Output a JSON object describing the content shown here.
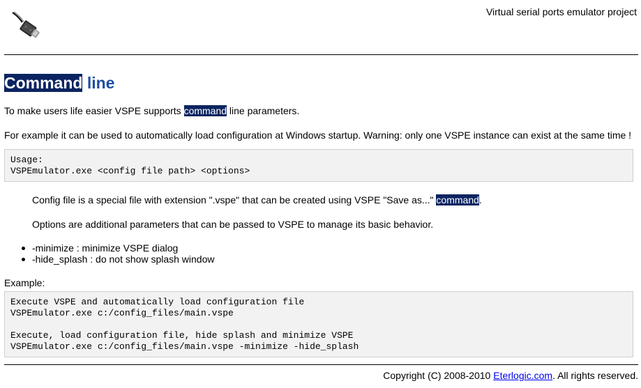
{
  "header": {
    "site_title": "Virtual serial ports emulator project",
    "logo_icon": "serial-cable-icon"
  },
  "main": {
    "heading_highlight": "Command",
    "heading_rest": " line",
    "intro": {
      "before": "To make users life easier VSPE supports ",
      "highlight": "command",
      "after": " line parameters."
    },
    "example_paragraph": "For example it can be used to automatically load configuration at Windows startup. Warning: only one VSPE instance can exist at the same time !",
    "usage_code": "Usage:\nVSPEmulator.exe <config file path> <options>",
    "config_note": {
      "before": "Config file is a special file with extension \".vspe\" that can be created using VSPE \"Save as...\" ",
      "highlight": "command",
      "after": "."
    },
    "options_note": "Options are additional parameters that can be passed to VSPE to manage its basic behavior.",
    "options": [
      "-minimize : minimize VSPE dialog",
      "-hide_splash : do not show splash window"
    ],
    "example_label": "Example:",
    "example_code": "Execute VSPE and automatically load configuration file\nVSPEmulator.exe c:/config_files/main.vspe\n\nExecute, load configuration file, hide splash and minimize VSPE\nVSPEmulator.exe c:/config_files/main.vspe -minimize -hide_splash"
  },
  "footer": {
    "copyright_before": "Copyright (C) 2008-2010 ",
    "link_text": "Eterlogic.com",
    "copyright_after": ". All rights reserved."
  },
  "colors": {
    "heading": "#1f4ea3",
    "highlight_bg": "#0b2461",
    "highlight_fg": "#ffffff",
    "code_bg": "#f2f2f2",
    "code_border": "#cfcfcf",
    "link": "#0000ee"
  }
}
